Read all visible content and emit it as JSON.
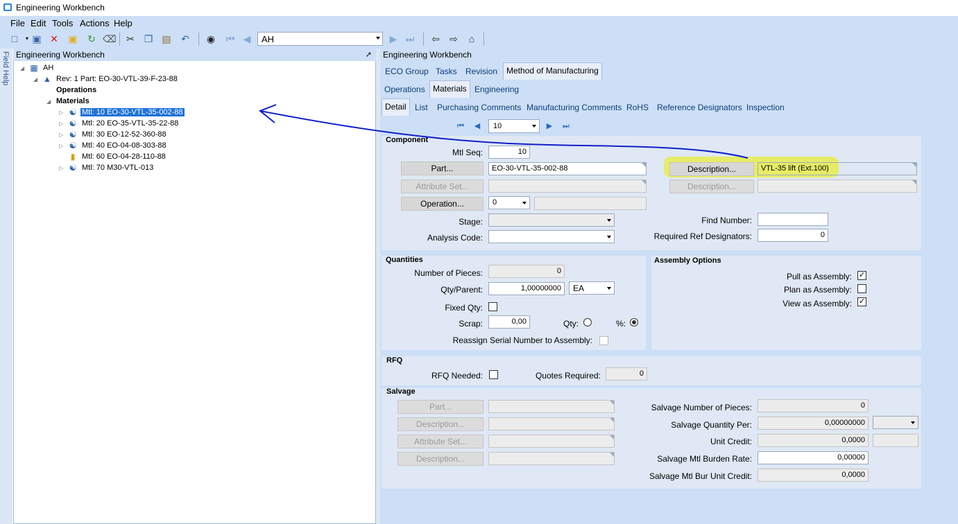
{
  "window": {
    "title": "Engineering Workbench"
  },
  "menu": [
    "File",
    "Edit",
    "Tools",
    "Actions",
    "Help"
  ],
  "toolbar": {
    "search_value": "AH"
  },
  "field_help": "Field Help",
  "left_pane": {
    "header": "Engineering Workbench",
    "tree": {
      "root": "AH",
      "rev": "Rev: 1 Part: EO-30-VTL-39-F-23-88",
      "operations": "Operations",
      "materials": "Materials",
      "items": [
        "Mtl: 10 EO-30-VTL-35-002-88",
        "Mtl: 20 EO-35-VTL-35-22-88",
        "Mtl: 30 EO-12-52-360-88",
        "Mtl: 40 EO-04-08-303-88",
        "Mtl: 60 EO-04-28-110-88",
        "Mtl: 70 M30-VTL-013"
      ]
    }
  },
  "right_pane": {
    "header": "Engineering Workbench",
    "tabs1": [
      "ECO Group",
      "Tasks",
      "Revision",
      "Method of Manufacturing"
    ],
    "tabs2": [
      "Operations",
      "Materials",
      "Engineering"
    ],
    "tabs3": [
      "Detail",
      "List",
      "Purchasing Comments",
      "Manufacturing Comments",
      "RoHS",
      "Reference Designators",
      "Inspection"
    ],
    "nav_value": "10"
  },
  "component": {
    "title": "Component",
    "mtl_seq_label": "Mtl Seq:",
    "mtl_seq": "10",
    "part_btn": "Part...",
    "part": "EO-30-VTL-35-002-88",
    "attr_btn": "Attribute Set...",
    "operation_btn": "Operation...",
    "operation": "0",
    "stage_label": "Stage:",
    "analysis_label": "Analysis Code:",
    "desc_btn": "Description...",
    "desc": "VTL-35 lift (Ext.100)",
    "desc2_btn": "Description...",
    "find_label": "Find Number:",
    "req_ref_label": "Required Ref Designators:",
    "req_ref": "0"
  },
  "quantities": {
    "title": "Quantities",
    "pieces_label": "Number of Pieces:",
    "pieces": "0",
    "qty_label": "Qty/Parent:",
    "qty": "1,00000000",
    "uom": "EA",
    "fixed_label": "Fixed Qty:",
    "scrap_label": "Scrap:",
    "scrap": "0,00",
    "qty_radio": "Qty:",
    "pct_radio": "%:",
    "reassign_label": "Reassign Serial Number to Assembly:"
  },
  "assembly": {
    "title": "Assembly Options",
    "pull": "Pull as Assembly:",
    "plan": "Plan as Assembly:",
    "view": "View as Assembly:",
    "pull_checked": true,
    "plan_checked": false,
    "view_checked": true
  },
  "rfq": {
    "title": "RFQ",
    "needed_label": "RFQ Needed:",
    "quotes_label": "Quotes Required:",
    "quotes": "0"
  },
  "salvage": {
    "title": "Salvage",
    "part_btn": "Part...",
    "desc_btn": "Description...",
    "attr_btn": "Attribute Set...",
    "desc2_btn": "Description...",
    "num_label": "Salvage Number of Pieces:",
    "num": "0",
    "qty_label": "Salvage Quantity Per:",
    "qty": "0,00000000",
    "credit_label": "Unit Credit:",
    "credit": "0,0000",
    "burden_label": "Salvage Mtl Burden Rate:",
    "burden": "0,00000",
    "bur_unit_label": "Salvage Mtl Bur Unit Credit:",
    "bur_unit": "0,0000"
  },
  "colors": {
    "accent": "#1e72d8",
    "panel": "#ccdff6",
    "annotation": "#1020c8",
    "highlight": "#e9ec4c"
  }
}
